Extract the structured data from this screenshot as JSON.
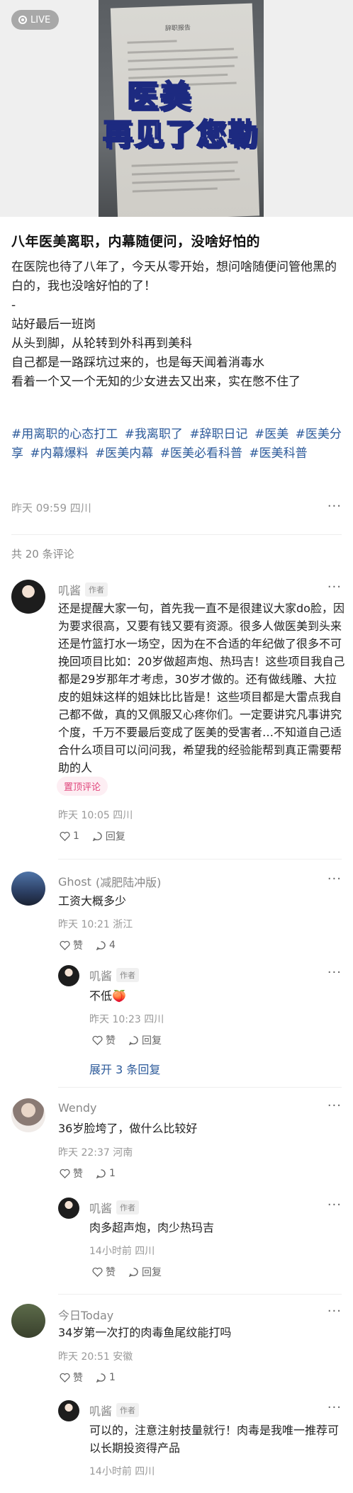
{
  "hero": {
    "live_label": "LIVE",
    "paper_title": "辞职报告",
    "overlay_line1": "医美",
    "overlay_line2": "再见了您勒"
  },
  "post": {
    "title": "八年医美离职，内幕随便问，没啥好怕的",
    "body": "在医院也待了八年了，今天从零开始，想问啥随便问管他黑的白的，我也没啥好怕的了！\n-\n站好最后一班岗\n从头到脚，从轮转到外科再到美科\n自己都是一路踩坑过来的，也是每天闻着消毒水\n看着一个又一个无知的少女进去又出来，实在憋不住了",
    "tags": [
      "#用离职的心态打工",
      "#我离职了",
      "#辞职日记",
      "#医美",
      "#医美分享",
      "#内幕爆料",
      "#医美内幕",
      "#医美必看科普",
      "#医美科普"
    ],
    "meta": "昨天 09:59 四川"
  },
  "comments_header": "共 20 条评论",
  "author_tag": "作者",
  "comments": [
    {
      "name": "叽酱",
      "text": "还是提醒大家一句，首先我一直不是很建议大家do脸，因为要求很高，又要有钱又要有资源。很多人做医美到头来还是竹篮打水一场空，因为在不合适的年纪做了很多不可挽回项目比如：20岁做超声炮、热玛吉！这些项目我自己都是29岁那年才考虑，30岁才做的。还有做线雕、大拉皮的姐妹这样的姐妹比比皆是！这些项目都是大雷点我自己都不做，真的又佩服又心疼你们。一定要讲究凡事讲究个度，千万不要最后变成了医美的受害者…不知道自己适合什么项目可以问问我，希望我的经验能帮到真正需要帮助的人",
      "pin": "置顶评论",
      "time": "昨天 10:05 四川",
      "likes": "1",
      "reply": "回复"
    },
    {
      "name": "Ghost",
      "name_note": "(减肥陆冲版)",
      "text": "工资大概多少",
      "time": "昨天 10:21 浙江",
      "likes": "赞",
      "replies": "4",
      "sub": {
        "name": "叽酱",
        "text": "不低🍑",
        "time": "昨天 10:23 四川",
        "likes": "赞",
        "reply": "回复"
      },
      "expand": "展开 3 条回复"
    },
    {
      "name": "Wendy",
      "text": "36岁脸垮了，做什么比较好",
      "time": "昨天 22:37 河南",
      "likes": "赞",
      "replies": "1",
      "sub": {
        "name": "叽酱",
        "text": "肉多超声炮，肉少热玛吉",
        "time": "14小时前 四川",
        "likes": "赞",
        "reply": "回复"
      }
    },
    {
      "name": "今日Today",
      "text": "34岁第一次打的肉毒鱼尾纹能打吗",
      "time": "昨天 20:51 安徽",
      "likes": "赞",
      "replies": "1",
      "sub": {
        "name": "叽酱",
        "text": "可以的，注意注射技量就行！肉毒是我唯一推荐可以长期投资得产品",
        "time": "14小时前 四川"
      }
    }
  ]
}
